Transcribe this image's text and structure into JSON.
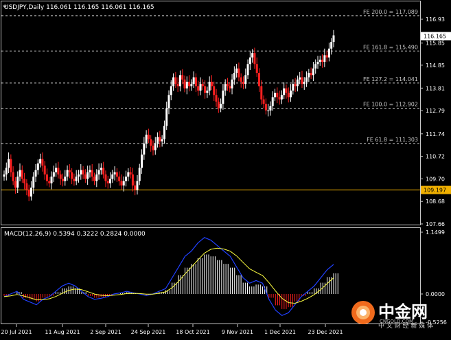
{
  "main_header": "USDJPY,Daily  116.061 116.165 116.061 116.165",
  "macd_header": "MACD(12,26,9) 0.5394 0.3222 0.2824 0.0000",
  "chart_data": [
    {
      "type": "candlestick",
      "title": "USDJPY,Daily",
      "ohlc_last": {
        "open": 116.061,
        "high": 116.165,
        "low": 116.061,
        "close": 116.165
      },
      "ylim": [
        107.5,
        117.5
      ],
      "yticks": [
        116.93,
        115.85,
        114.85,
        113.81,
        112.79,
        111.74,
        110.72,
        109.7,
        108.68,
        107.66
      ],
      "xticks": [
        "20 Jul 2021",
        "11 Aug 2021",
        "2 Sep 2021",
        "24 Sep 2021",
        "18 Oct 2021",
        "9 Nov 2021",
        "1 Dec 2021",
        "23 Dec 2021"
      ],
      "last_price_label": "116.165",
      "baseline_label": "109.197",
      "levels": [
        {
          "label": "FE 200.0 = 117.089",
          "value": 117.089
        },
        {
          "label": "FE 161.8 = 115.490",
          "value": 115.49
        },
        {
          "label": "FE 127.2 = 114.041",
          "value": 114.041
        },
        {
          "label": "FE 100.0 = 112.902",
          "value": 112.902
        },
        {
          "label": "FE 61.8 = 111.303",
          "value": 111.303
        }
      ],
      "series_approx_close": [
        109.9,
        110.2,
        110.6,
        110.0,
        109.6,
        109.3,
        109.8,
        110.1,
        109.7,
        109.5,
        109.2,
        108.9,
        109.3,
        109.8,
        110.1,
        110.4,
        110.6,
        110.3,
        109.9,
        109.6,
        109.5,
        109.8,
        110.0,
        110.2,
        109.9,
        109.7,
        109.6,
        109.8,
        110.1,
        110.0,
        109.7,
        109.6,
        109.8,
        109.9,
        110.1,
        109.9,
        109.7,
        110.0,
        110.1,
        109.8,
        109.6,
        109.9,
        110.1,
        110.2,
        109.9,
        109.6,
        109.5,
        109.7,
        109.9,
        110.0,
        109.8,
        109.6,
        109.4,
        109.6,
        109.8,
        110.0,
        109.9,
        109.4,
        109.2,
        109.6,
        110.2,
        110.8,
        111.3,
        111.7,
        111.5,
        111.2,
        111.0,
        111.3,
        111.6,
        111.4,
        111.5,
        112.1,
        112.9,
        113.5,
        113.9,
        114.3,
        114.0,
        113.9,
        114.4,
        114.2,
        113.8,
        114.1,
        113.9,
        114.0,
        114.3,
        113.9,
        113.7,
        114.0,
        113.9,
        113.6,
        113.7,
        114.1,
        113.9,
        113.5,
        113.2,
        112.9,
        113.1,
        113.7,
        114.0,
        113.9,
        113.8,
        114.2,
        114.5,
        114.7,
        114.3,
        114.1,
        114.0,
        114.4,
        114.9,
        115.2,
        115.4,
        114.9,
        114.5,
        113.9,
        113.3,
        113.1,
        112.8,
        112.8,
        113.0,
        113.4,
        113.6,
        113.4,
        113.3,
        113.5,
        113.8,
        113.6,
        113.4,
        113.7,
        114.0,
        113.9,
        114.2,
        114.3,
        114.0,
        114.1,
        114.3,
        114.5,
        114.4,
        114.7,
        114.9,
        115.0,
        115.1,
        115.0,
        115.3,
        115.2,
        115.6,
        115.9,
        116.2
      ]
    },
    {
      "type": "macd",
      "title": "MACD(12,26,9)",
      "values": {
        "main": 0.5394,
        "signal": 0.3222,
        "histogram": 0.2824,
        "zero": 0.0
      },
      "ylim": [
        -0.5256,
        1.1499
      ],
      "yticks": [
        1.1499,
        0.0,
        -0.5256
      ],
      "series_approx": [
        -0.05,
        0.0,
        0.05,
        -0.1,
        -0.15,
        -0.2,
        -0.1,
        -0.05,
        0.05,
        0.15,
        0.2,
        0.15,
        0.05,
        -0.05,
        -0.1,
        -0.08,
        -0.05,
        0.0,
        0.02,
        0.05,
        0.02,
        0.0,
        -0.03,
        0.0,
        0.05,
        0.1,
        0.3,
        0.5,
        0.7,
        0.8,
        0.95,
        1.05,
        1.0,
        0.9,
        0.8,
        0.7,
        0.5,
        0.3,
        0.2,
        0.25,
        0.2,
        -0.1,
        -0.3,
        -0.4,
        -0.35,
        -0.2,
        -0.05,
        0.05,
        0.15,
        0.3,
        0.45,
        0.55
      ]
    }
  ],
  "watermark": {
    "brand": "中金网",
    "domain": "CNGOLD.COM",
    "tagline": "中 文 财 经 新 媒 体"
  }
}
